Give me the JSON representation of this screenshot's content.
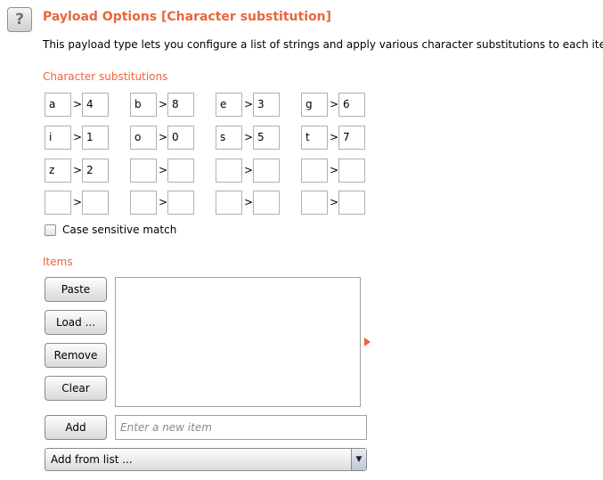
{
  "header": {
    "help_icon": "?",
    "title": "Payload Options [Character substitution]",
    "description": "This payload type lets you configure a list of strings and apply various character substitutions to each item."
  },
  "substitutions": {
    "label": "Character substitutions",
    "separator": ">",
    "rows": [
      [
        {
          "from": "a",
          "to": "4"
        },
        {
          "from": "b",
          "to": "8"
        },
        {
          "from": "e",
          "to": "3"
        },
        {
          "from": "g",
          "to": "6"
        }
      ],
      [
        {
          "from": "i",
          "to": "1"
        },
        {
          "from": "o",
          "to": "0"
        },
        {
          "from": "s",
          "to": "5"
        },
        {
          "from": "t",
          "to": "7"
        }
      ],
      [
        {
          "from": "z",
          "to": "2"
        },
        {
          "from": "",
          "to": ""
        },
        {
          "from": "",
          "to": ""
        },
        {
          "from": "",
          "to": ""
        }
      ],
      [
        {
          "from": "",
          "to": ""
        },
        {
          "from": "",
          "to": ""
        },
        {
          "from": "",
          "to": ""
        },
        {
          "from": "",
          "to": ""
        }
      ]
    ]
  },
  "case_sensitive": {
    "label": "Case sensitive match",
    "checked": false
  },
  "items": {
    "label": "Items",
    "buttons": {
      "paste": "Paste",
      "load": "Load ...",
      "remove": "Remove",
      "clear": "Clear",
      "add": "Add"
    },
    "list": [],
    "new_item_placeholder": "Enter a new item",
    "add_from_list": "Add from list ..."
  },
  "colors": {
    "accent": "#e8663a"
  }
}
